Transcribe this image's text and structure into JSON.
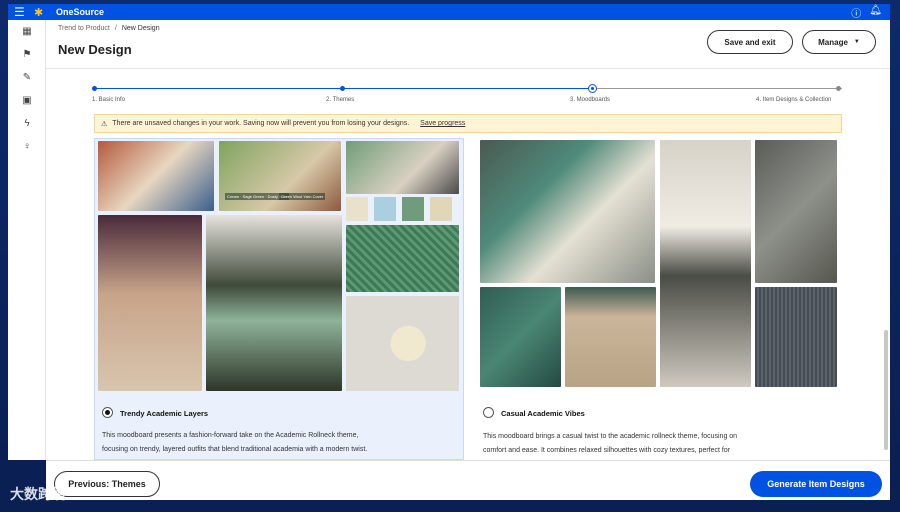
{
  "app": {
    "brand": "OneSource"
  },
  "breadcrumb": {
    "parent": "Trend to Product",
    "separator": "/",
    "current": "New Design"
  },
  "page": {
    "title": "New Design"
  },
  "actions": {
    "save_exit": "Save and exit",
    "manage": "Manage"
  },
  "stepper": {
    "steps": [
      {
        "label": "1. Basic Info",
        "state": "done"
      },
      {
        "label": "2. Themes",
        "state": "done"
      },
      {
        "label": "3. Moodboards",
        "state": "current"
      },
      {
        "label": "4. Item Designs & Collection",
        "state": "todo"
      }
    ]
  },
  "warning": {
    "text": "There are unsaved changes in your work. Saving now will prevent you from losing your designs.",
    "link": "Save progress"
  },
  "moodboards": [
    {
      "name": "Trendy Academic Layers",
      "selected": true,
      "desc_line1": "This moodboard presents a fashion-forward take on the Academic Rollneck theme,",
      "desc_line2": "focusing on trendy, layered outfits that blend traditional academia with a modern twist.",
      "chip1": "Cream · Sage Green · Dusty Blue",
      "chip2": "Green Wool Yarn Cover"
    },
    {
      "name": "Casual Academic Vibes",
      "selected": false,
      "desc_line1": "This moodboard brings a casual twist to the academic rollneck theme, focusing on",
      "desc_line2": "comfort and ease. It combines relaxed silhouettes with cozy textures, perfect for"
    }
  ],
  "footer": {
    "previous": "Previous: Themes",
    "generate": "Generate Item Designs"
  },
  "watermark": "大数跨境",
  "colors": {
    "primary": "#0053e2",
    "warning_bg": "#fff4d6",
    "selected_card": "#eaf1fd"
  }
}
